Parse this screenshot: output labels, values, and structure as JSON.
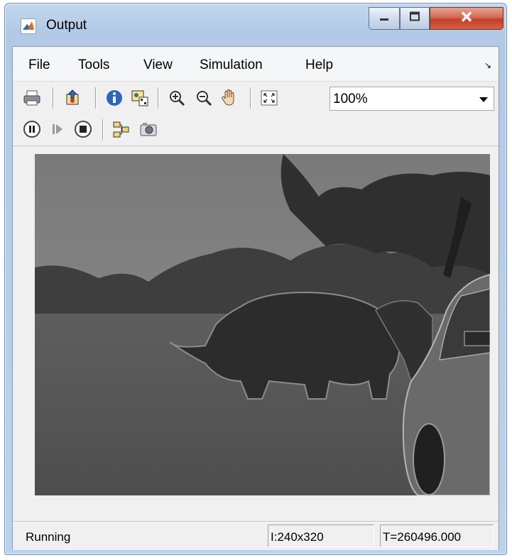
{
  "window": {
    "title": "Output",
    "app_icon": "matlab-logo-icon"
  },
  "title_controls": {
    "minimize_icon": "minimize-icon",
    "maximize_icon": "maximize-icon",
    "close_icon": "close-icon",
    "close_color": "#c8402b"
  },
  "menu": {
    "items": [
      "File",
      "Tools",
      "View",
      "Simulation",
      "Help"
    ],
    "dock_icon": "undock-arrow-icon"
  },
  "toolbar": {
    "icons": [
      "print-icon",
      "highlight-simulink-block-icon",
      "info-icon",
      "colormap-icon",
      "zoom-in-icon",
      "zoom-out-icon",
      "pan-hand-icon",
      "fit-to-view-icon"
    ],
    "zoom": {
      "value": "100%"
    }
  },
  "playback": {
    "icons": [
      "pause-icon",
      "step-forward-icon",
      "stop-icon",
      "simulink-model-icon",
      "snapshot-camera-icon"
    ]
  },
  "image": {
    "description_icon": "video-frame-grayscale-edges"
  },
  "status": {
    "text": "Running",
    "dimensions": "I:240x320",
    "time": "T=260496.000"
  }
}
